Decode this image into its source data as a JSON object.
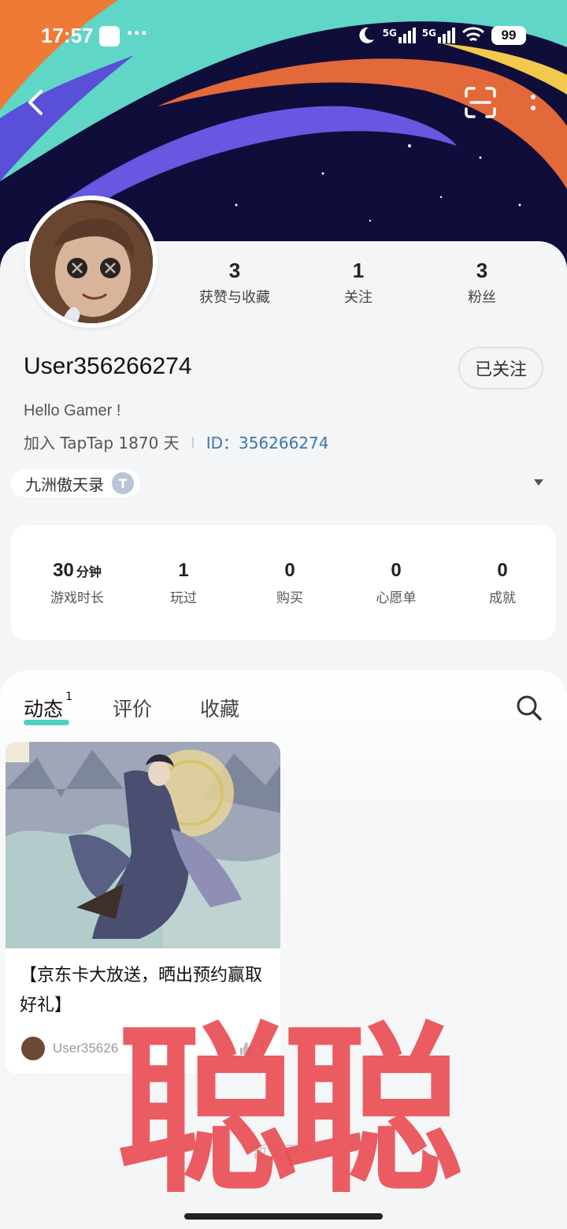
{
  "status_bar": {
    "time": "17:57",
    "more": "···",
    "signal1": "5G",
    "signal2": "5G",
    "battery": "99"
  },
  "profile": {
    "username": "User356266274",
    "follow_button": "已关注",
    "bio": "Hello Gamer !",
    "join_text": "加入 TapTap 1870 天",
    "id_text": "ID：356266274",
    "stats": [
      {
        "value": "3",
        "label": "获赞与收藏"
      },
      {
        "value": "1",
        "label": "关注"
      },
      {
        "value": "3",
        "label": "粉丝"
      }
    ],
    "game_chip": {
      "name": "九洲傲天录",
      "badge": "T"
    }
  },
  "game_stats": {
    "playtime_value": "30",
    "playtime_unit": "分钟",
    "playtime_label": "游戏时长",
    "items": [
      {
        "value": "1",
        "label": "玩过"
      },
      {
        "value": "0",
        "label": "购买"
      },
      {
        "value": "0",
        "label": "心愿单"
      },
      {
        "value": "0",
        "label": "成就"
      }
    ]
  },
  "tabs": [
    {
      "label": "动态",
      "badge": "1"
    },
    {
      "label": "评价"
    },
    {
      "label": "收藏"
    }
  ],
  "post": {
    "title": "【京东卡大放送，晒出预约赢取好礼】",
    "author": "User35626",
    "likes": "1"
  },
  "empty_note": "暂无更多",
  "watermark": "聪聪",
  "colors": {
    "accent_underline": "#4fd0c5",
    "id_link": "#3a77a8",
    "watermark": "#e84e54",
    "banner_bg": "#0f0d3a"
  }
}
